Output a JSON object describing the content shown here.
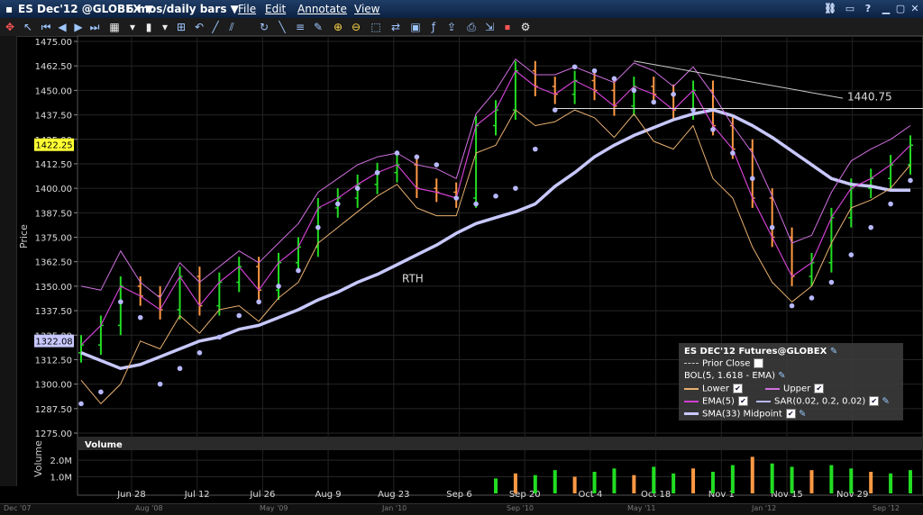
{
  "title_bar": {
    "instrument": "ES Dec'12 @GLOBEX",
    "period": "6 mos/daily bars",
    "menus": [
      "File",
      "Edit",
      "Annotate",
      "View"
    ]
  },
  "axis": {
    "price_label": "Price",
    "volume_label": "Volume",
    "volume_panel_title": "Volume",
    "price_ticks": [
      "1475.00",
      "1462.50",
      "1450.00",
      "1437.50",
      "1425.00",
      "1412.50",
      "1400.00",
      "1387.50",
      "1375.00",
      "1362.50",
      "1350.00",
      "1337.50",
      "1325.00",
      "1312.50",
      "1300.00",
      "1287.50",
      "1275.00"
    ],
    "volume_ticks": [
      "2.0M",
      "1.0M"
    ],
    "date_labels": [
      "Jun 28",
      "Jul 12",
      "Jul 26",
      "Aug 9",
      "Aug 23",
      "Sep 6",
      "Sep 20",
      "Oct 4",
      "Oct 18",
      "Nov 1",
      "Nov 15",
      "Nov 29"
    ],
    "price_badges": {
      "current": "1422.25",
      "other": "1322.08"
    }
  },
  "annotations": {
    "level": "1440.75",
    "rth": "RTH"
  },
  "legend": {
    "header": "ES DEC'12 Futures@GLOBEX",
    "prior_close": "Prior Close",
    "bol": "BOL(5, 1.618 - EMA)",
    "lower": "Lower",
    "upper": "Upper",
    "ema": "EMA(5)",
    "sar": "SAR(0.02, 0.2, 0.02)",
    "sma": "SMA(33) Midpoint"
  },
  "bottom_bar": [
    "Dec '07",
    "Aug '08",
    "May '09",
    "Jan '10",
    "Sep '10",
    "May '11",
    "Jan '12",
    "Sep '12"
  ],
  "colors": {
    "up": "#22dd22",
    "down": "#ff9944",
    "bollinger_lower": "#e8b070",
    "bollinger_upper": "#d070e0",
    "ema": "#d040d0",
    "sma": "#c8c8ff",
    "sar": "#b8b8ff"
  },
  "chart_data": {
    "type": "line",
    "ylim": [
      1275,
      1475
    ],
    "volume_ylim": [
      0,
      2600000
    ],
    "price_series": [
      {
        "name": "SMA(33) Midpoint",
        "values": [
          1316,
          1312,
          1308,
          1310,
          1314,
          1318,
          1322,
          1324,
          1328,
          1330,
          1334,
          1338,
          1343,
          1347,
          1352,
          1356,
          1361,
          1366,
          1371,
          1377,
          1382,
          1385,
          1388,
          1392,
          1401,
          1408,
          1416,
          1422,
          1427,
          1431,
          1435,
          1438,
          1440,
          1437,
          1432,
          1426,
          1419,
          1412,
          1405,
          1402,
          1401,
          1399,
          1399
        ]
      },
      {
        "name": "EMA(5)",
        "values": [
          1320,
          1330,
          1350,
          1345,
          1338,
          1355,
          1340,
          1352,
          1360,
          1348,
          1362,
          1370,
          1390,
          1395,
          1402,
          1408,
          1412,
          1400,
          1398,
          1395,
          1432,
          1440,
          1460,
          1452,
          1448,
          1455,
          1450,
          1442,
          1452,
          1448,
          1440,
          1450,
          1432,
          1420,
          1395,
          1375,
          1355,
          1362,
          1385,
          1400,
          1405,
          1412,
          1422
        ]
      },
      {
        "name": "Upper",
        "values": [
          1350,
          1348,
          1368,
          1352,
          1344,
          1362,
          1352,
          1360,
          1368,
          1362,
          1372,
          1382,
          1398,
          1405,
          1412,
          1416,
          1418,
          1412,
          1410,
          1405,
          1438,
          1450,
          1466,
          1458,
          1458,
          1462,
          1458,
          1454,
          1464,
          1460,
          1452,
          1462,
          1448,
          1432,
          1418,
          1396,
          1372,
          1376,
          1398,
          1414,
          1420,
          1425,
          1432
        ]
      },
      {
        "name": "Lower",
        "values": [
          1302,
          1290,
          1300,
          1322,
          1318,
          1335,
          1326,
          1338,
          1340,
          1332,
          1344,
          1352,
          1372,
          1380,
          1388,
          1396,
          1402,
          1390,
          1386,
          1386,
          1418,
          1422,
          1440,
          1432,
          1434,
          1440,
          1436,
          1426,
          1438,
          1424,
          1420,
          1432,
          1405,
          1395,
          1370,
          1352,
          1342,
          1350,
          1372,
          1390,
          1394,
          1400,
          1412
        ]
      }
    ],
    "sar": [
      1290,
      1296,
      1342,
      1334,
      1300,
      1308,
      1316,
      1324,
      1335,
      1342,
      1350,
      1358,
      1380,
      1392,
      1400,
      1408,
      1418,
      1416,
      1412,
      1395,
      1392,
      1396,
      1400,
      1420,
      1440,
      1462,
      1460,
      1456,
      1450,
      1444,
      1448,
      1440,
      1430,
      1418,
      1405,
      1380,
      1340,
      1344,
      1352,
      1366,
      1380,
      1392,
      1404
    ],
    "volume": [
      0,
      0,
      0,
      0,
      0,
      0,
      0,
      0,
      0,
      0,
      0,
      0,
      0,
      0,
      0,
      0,
      0,
      0,
      0,
      0,
      0,
      900000,
      1200000,
      1100000,
      1400000,
      1000000,
      1300000,
      1500000,
      1100000,
      1600000,
      1200000,
      1500000,
      1300000,
      1700000,
      2200000,
      1800000,
      1600000,
      1400000,
      1700000,
      1500000,
      1300000,
      1200000,
      1400000
    ],
    "last_price": 1422.25,
    "resistance_level": 1440.75
  }
}
